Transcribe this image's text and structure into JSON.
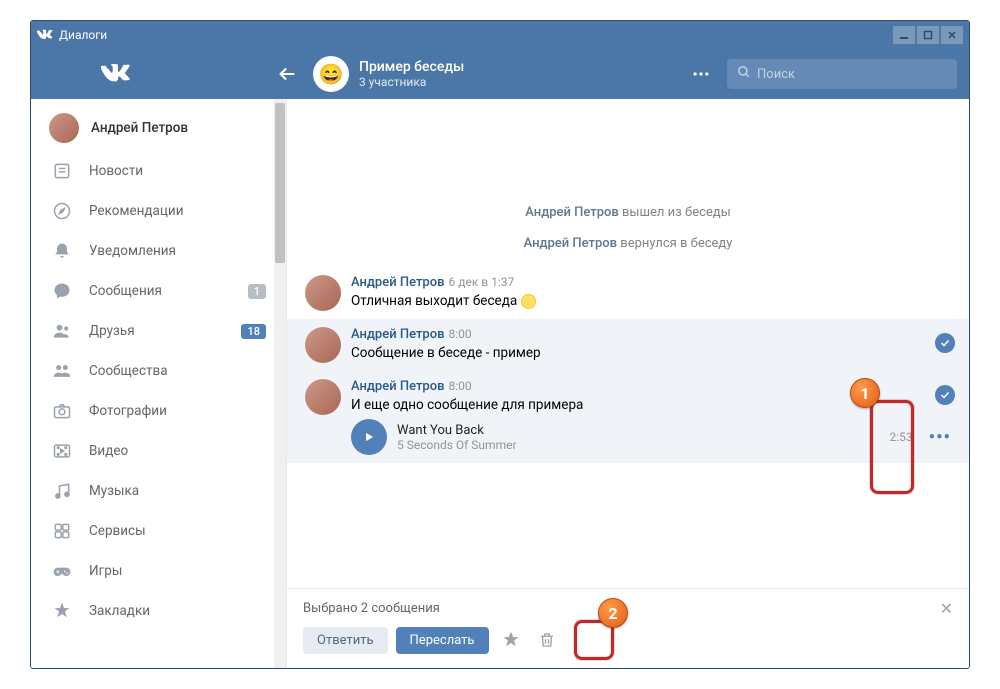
{
  "window": {
    "title": "Диалоги"
  },
  "header": {
    "chat_title": "Пример беседы",
    "chat_subtitle": "3 участника",
    "search_placeholder": "Поиск",
    "chat_avatar_emoji": "😄"
  },
  "sidebar": {
    "profile_name": "Андрей Петров",
    "items": [
      {
        "icon": "news",
        "label": "Новости"
      },
      {
        "icon": "compass",
        "label": "Рекомендации"
      },
      {
        "icon": "bell",
        "label": "Уведомления"
      },
      {
        "icon": "bubble",
        "label": "Сообщения",
        "badge": "1",
        "badge_muted": true
      },
      {
        "icon": "friends",
        "label": "Друзья",
        "badge": "18"
      },
      {
        "icon": "groups",
        "label": "Сообщества"
      },
      {
        "icon": "camera",
        "label": "Фотографии"
      },
      {
        "icon": "video",
        "label": "Видео"
      },
      {
        "icon": "music",
        "label": "Музыка"
      },
      {
        "icon": "services",
        "label": "Сервисы"
      },
      {
        "icon": "games",
        "label": "Игры"
      },
      {
        "icon": "bookmark",
        "label": "Закладки"
      }
    ]
  },
  "messages": {
    "system": [
      {
        "user": "Андрей Петров",
        "text": " вышел из беседы"
      },
      {
        "user": "Андрей Петров",
        "text": " вернулся в беседу"
      }
    ],
    "items": [
      {
        "author": "Андрей Петров",
        "time": "6 дек в 1:37",
        "text": "Отличная выходит беседа "
      },
      {
        "author": "Андрей Петров",
        "time": "8:00",
        "text": "Сообщение в беседе - пример"
      },
      {
        "author": "Андрей Петров",
        "time": "8:00",
        "text": "И еще одно сообщение для примера"
      }
    ],
    "audio": {
      "title": "Want You Back",
      "artist": "5 Seconds Of Summer",
      "duration": "2:53"
    }
  },
  "selection": {
    "text": "Выбрано 2 сообщения",
    "reply": "Ответить",
    "forward": "Переслать"
  }
}
